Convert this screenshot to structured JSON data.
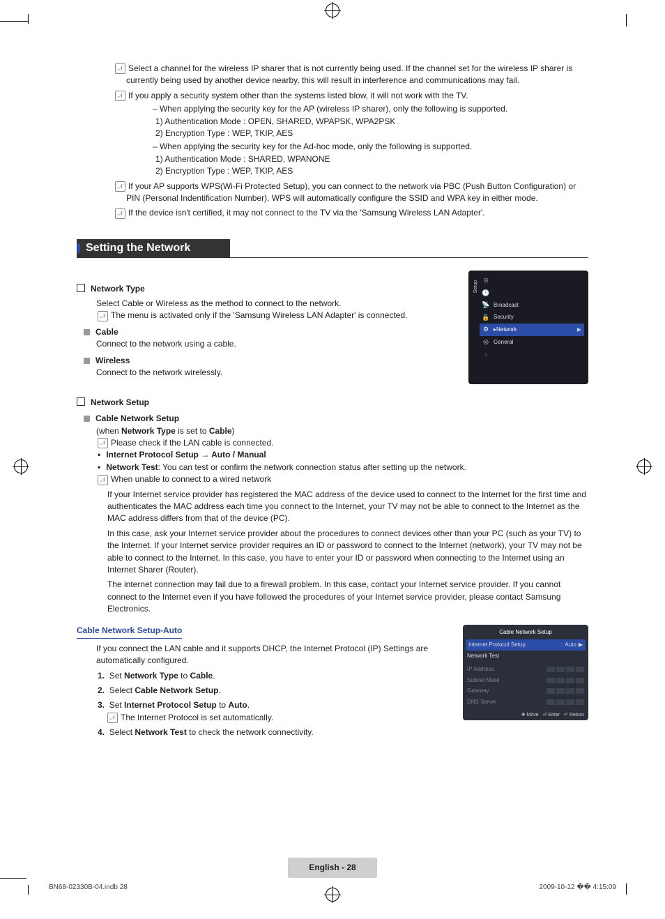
{
  "notes": {
    "a": "Select a channel for the wireless IP sharer that is not currently being used. If the channel set for the wireless IP sharer is currently being used by another device nearby, this will result in interference and communications may fail.",
    "b": "If you apply a security system other than the systems listed blow, it will not work with the TV.",
    "b1": "When applying the security key for the AP (wireless IP sharer), only the following is supported.",
    "b1a": "1) Authentication Mode : OPEN, SHARED, WPAPSK, WPA2PSK",
    "b1b": "2) Encryption Type : WEP, TKIP, AES",
    "b2": "When applying the security key for the Ad-hoc mode, only the following is supported.",
    "b2a": "1) Authentication Mode : SHARED, WPANONE",
    "b2b": "2) Encryption Type : WEP, TKIP, AES",
    "c": "If your AP supports WPS(Wi-Fi Protected Setup), you can connect to the network via PBC (Push Button Configuration) or PIN (Personal Indentification Number). WPS will automatically configure the SSID and WPA key in either mode.",
    "d": "If the device isn't certified, it may not connect to the TV via the 'Samsung Wireless LAN Adapter'."
  },
  "section_heading": "Setting the Network",
  "network_type": {
    "title": "Network Type",
    "desc": "Select Cable or Wireless as the method to connect to the network.",
    "note": "The menu is activated only if the 'Samsung Wireless LAN Adapter' is connected.",
    "cable_title": "Cable",
    "cable_desc": "Connect to the network using a cable.",
    "wireless_title": "Wireless",
    "wireless_desc": "Connect to the network wirelessly."
  },
  "network_setup": {
    "title": "Network Setup",
    "cable_setup_title": "Cable Network Setup",
    "when": "(when Network Type is set to Cable)",
    "when_bold1": "Network Type",
    "when_bold2": "Cable",
    "note1": "Please check if the LAN cable is connected.",
    "ips": "Internet Protocol Setup → Auto / Manual",
    "nettest": "Network Test",
    "nettest_desc": ": You can test or confirm the network connection status after setting up the network.",
    "note2": "When unable to connect to a wired network",
    "p1": "If your Internet service provider has registered the MAC address of the device used to connect to the Internet for the first time and authenticates the MAC address each time you connect to the Internet, your TV may not be able to connect to the Internet as the MAC address differs from that of the device (PC).",
    "p2": "In this case, ask your Internet service provider about the procedures to connect devices other than your PC (such as your TV) to the Internet. If your Internet service provider requires an ID or password to connect to the Internet (network), your TV may not be able to connect to the Internet. In this case, you have to enter your ID or password when connecting to the Internet using an Internet Sharer (Router).",
    "p3": "The internet connection may fail due to a firewall problem. In this case, contact your Internet service provider. If you cannot connect to the Internet even if you have followed the procedures of your Internet service provider, please contact Samsung Electronics."
  },
  "auto": {
    "title": "Cable Network Setup-Auto",
    "desc": "If you connect the LAN cable and it supports DHCP, the Internet Protocol (IP) Settings are automatically configured.",
    "s1_pre": "Set ",
    "s1_bold1": "Network Type",
    "s1_mid": " to ",
    "s1_bold2": "Cable",
    "s1_post": ".",
    "s2_pre": "Select ",
    "s2_bold": "Cable Network Setup",
    "s2_post": ".",
    "s3_pre": "Set ",
    "s3_bold": "Internet Protocol Setup",
    "s3_mid": " to ",
    "s3_bold2": "Auto",
    "s3_post": ".",
    "s3_note": "The Internet Protocol is set automatically.",
    "s4_pre": "Select ",
    "s4_bold": "Network Test",
    "s4_post": " to check the network connectivity."
  },
  "osd1": {
    "setup": "Setup",
    "items": [
      "Broadcast",
      "Security",
      "Network",
      "General"
    ],
    "selected": "Network"
  },
  "osd2": {
    "title": "Cable Network Setup",
    "ips_label": "Internet Protocol Setup",
    "ips_value": "Auto",
    "network_test": "Network Test",
    "rows": [
      "IP Address",
      "Subnet Mask",
      "Gateway",
      "DNS Server"
    ],
    "foot_move": "Move",
    "foot_enter": "Enter",
    "foot_return": "Return"
  },
  "page_number": "English - 28",
  "footer_left": "BN68-02330B-04.indb   28",
  "footer_right": "2009-10-12   �� 4:15:09"
}
